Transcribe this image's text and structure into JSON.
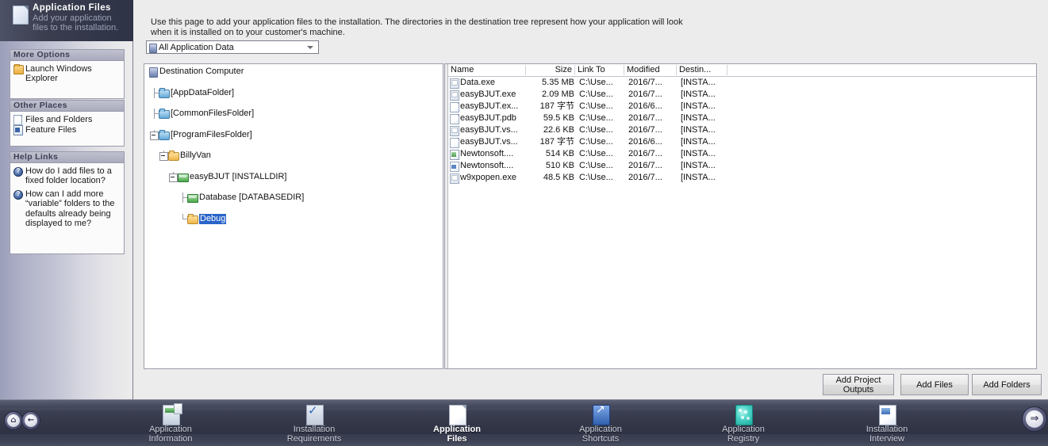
{
  "sidebar": {
    "header": {
      "title": "Application Files",
      "subtitle": "Add your application files to the installation.",
      "icon": "file-page-icon"
    },
    "sections": [
      {
        "title": "More Options",
        "items": [
          {
            "label": "Launch Windows Explorer",
            "icon": "folder-icon"
          }
        ]
      },
      {
        "title": "Other Places",
        "items": [
          {
            "label": "Files and Folders",
            "icon": "document-icon"
          },
          {
            "label": "Feature Files",
            "icon": "feature-icon"
          }
        ]
      },
      {
        "title": "Help Links",
        "items": [
          {
            "label": "How do I add files to a fixed folder location?",
            "icon": "help-icon"
          },
          {
            "label": "How can I add more “variable” folders to the defaults already being displayed to me?",
            "icon": "help-icon"
          }
        ]
      }
    ]
  },
  "main": {
    "intro": "Use this page to add your application files to the installation. The directories in the destination tree represent how your application will look when it is installed on to your customer's machine.",
    "filter_combo": {
      "value": "All Application Data",
      "icon": "data-folder-icon",
      "arrow": "chevron-down-icon"
    },
    "tree": {
      "root": "Destination Computer",
      "nodes": [
        {
          "label": "[AppDataFolder]",
          "icon": "folder-blue-icon",
          "depth": 1,
          "expander": "none",
          "selected": false
        },
        {
          "label": "[CommonFilesFolder]",
          "icon": "folder-blue-icon",
          "depth": 1,
          "expander": "none",
          "selected": false
        },
        {
          "label": "[ProgramFilesFolder]",
          "icon": "folder-blue-icon",
          "depth": 1,
          "expander": "minus",
          "selected": false
        },
        {
          "label": "BillyVan",
          "icon": "folder-yellow-icon",
          "depth": 2,
          "expander": "minus",
          "selected": false
        },
        {
          "label": "easyBJUT  [INSTALLDIR]",
          "icon": "package-icon",
          "depth": 3,
          "expander": "minus",
          "selected": false
        },
        {
          "label": "Database  [DATABASEDIR]",
          "icon": "package-icon",
          "depth": 4,
          "expander": "none",
          "selected": false
        },
        {
          "label": "Debug",
          "icon": "folder-yellow-icon",
          "depth": 4,
          "expander": "none",
          "selected": true
        }
      ]
    },
    "file_list": {
      "columns": [
        "Name",
        "Size",
        "Link To",
        "Modified",
        "Destin..."
      ],
      "rows": [
        {
          "icon": "exe-icon",
          "name": "Data.exe",
          "size": "5.35 MB",
          "link_to": "C:\\Use...",
          "modified": "2016/7...",
          "destination": "[INSTA..."
        },
        {
          "icon": "exe-icon",
          "name": "easyBJUT.exe",
          "size": "2.09 MB",
          "link_to": "C:\\Use...",
          "modified": "2016/7...",
          "destination": "[INSTA..."
        },
        {
          "icon": "file-icon",
          "name": "easyBJUT.ex...",
          "size": "187 字节",
          "link_to": "C:\\Use...",
          "modified": "2016/6...",
          "destination": "[INSTA..."
        },
        {
          "icon": "file-icon",
          "name": "easyBJUT.pdb",
          "size": "59.5 KB",
          "link_to": "C:\\Use...",
          "modified": "2016/7...",
          "destination": "[INSTA..."
        },
        {
          "icon": "exe-icon",
          "name": "easyBJUT.vs...",
          "size": "22.6 KB",
          "link_to": "C:\\Use...",
          "modified": "2016/7...",
          "destination": "[INSTA..."
        },
        {
          "icon": "file-icon",
          "name": "easyBJUT.vs...",
          "size": "187 字节",
          "link_to": "C:\\Use...",
          "modified": "2016/6...",
          "destination": "[INSTA..."
        },
        {
          "icon": "dll-icon",
          "name": "Newtonsoft....",
          "size": "514 KB",
          "link_to": "C:\\Use...",
          "modified": "2016/7...",
          "destination": "[INSTA..."
        },
        {
          "icon": "xml-icon",
          "name": "Newtonsoft....",
          "size": "510 KB",
          "link_to": "C:\\Use...",
          "modified": "2016/7...",
          "destination": "[INSTA..."
        },
        {
          "icon": "exe-icon",
          "name": "w9xpopen.exe",
          "size": "48.5 KB",
          "link_to": "C:\\Use...",
          "modified": "2016/7...",
          "destination": "[INSTA..."
        }
      ]
    },
    "buttons": [
      {
        "label": "Add Project Outputs"
      },
      {
        "label": "Add Files"
      },
      {
        "label": "Add Folders"
      }
    ]
  },
  "navbar": {
    "home_button": {
      "icon": "home-icon",
      "glyph": "⌂"
    },
    "back_button": {
      "icon": "back-arrow-icon",
      "glyph": "←"
    },
    "forward_button": {
      "icon": "forward-arrow-icon",
      "glyph": "⇒"
    },
    "items": [
      {
        "label_line1": "Application",
        "label_line2": "Information",
        "icon": "application-information-icon",
        "active": false
      },
      {
        "label_line1": "Installation",
        "label_line2": "Requirements",
        "icon": "installation-requirements-icon",
        "active": false
      },
      {
        "label_line1": "Application",
        "label_line2": "Files",
        "icon": "application-files-icon",
        "active": true
      },
      {
        "label_line1": "Application",
        "label_line2": "Shortcuts",
        "icon": "application-shortcuts-icon",
        "active": false
      },
      {
        "label_line1": "Application",
        "label_line2": "Registry",
        "icon": "application-registry-icon",
        "active": false
      },
      {
        "label_line1": "Installation",
        "label_line2": "Interview",
        "icon": "installation-interview-icon",
        "active": false
      }
    ]
  },
  "colors": {
    "selection_blue": "#2a64c8",
    "header_dark": "#33374a",
    "panel_bg": "#ececec",
    "sidebar_light": "#ececec"
  }
}
